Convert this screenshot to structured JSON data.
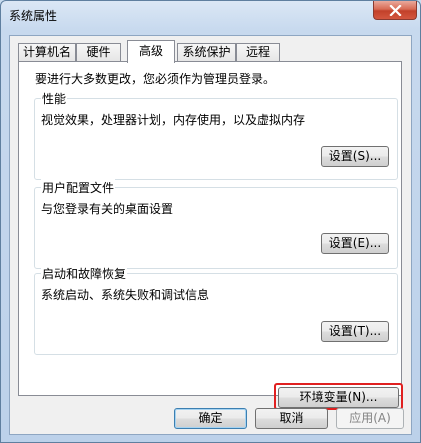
{
  "window": {
    "title": "系统属性",
    "close_icon": "close-icon"
  },
  "tabs": [
    {
      "label": "计算机名"
    },
    {
      "label": "硬件"
    },
    {
      "label": "高级",
      "active": true
    },
    {
      "label": "系统保护"
    },
    {
      "label": "远程"
    }
  ],
  "admin_note": "要进行大多数更改，您必须作为管理员登录。",
  "groups": {
    "performance": {
      "title": "性能",
      "desc": "视觉效果，处理器计划，内存使用，以及虚拟内存",
      "button": "设置(S)..."
    },
    "user_profiles": {
      "title": "用户配置文件",
      "desc": "与您登录有关的桌面设置",
      "button": "设置(E)..."
    },
    "startup_recovery": {
      "title": "启动和故障恢复",
      "desc": "系统启动、系统失败和调试信息",
      "button": "设置(T)..."
    }
  },
  "env_button": "环境变量(N)...",
  "footer": {
    "ok": "确定",
    "cancel": "取消",
    "apply": "应用(A)"
  },
  "colors": {
    "highlight": "#e02020",
    "close": "#c2412a"
  }
}
